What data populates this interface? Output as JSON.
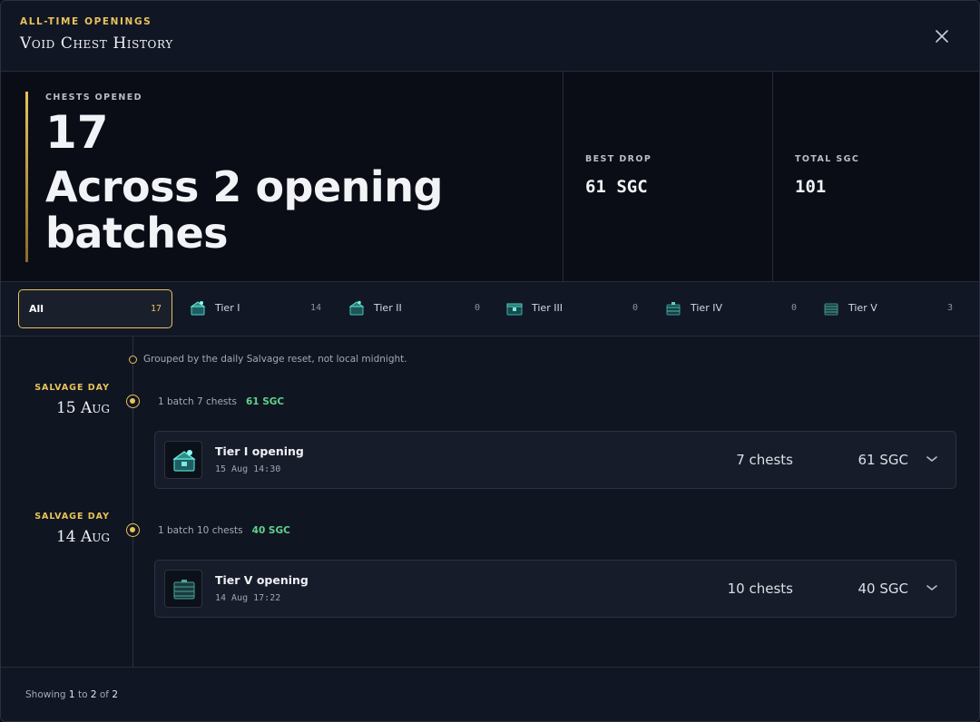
{
  "header": {
    "eyebrow": "ALL-TIME OPENINGS",
    "title": "Void Chest History",
    "close_icon": "close-icon"
  },
  "stats": {
    "opened_label": "CHESTS OPENED",
    "opened_value": "17",
    "opened_sub": "Across 2 opening batches",
    "best_label": "BEST DROP",
    "best_value": "61 SGC",
    "total_label": "TOTAL SGC",
    "total_value": "101"
  },
  "tabs": [
    {
      "label": "All",
      "count": "17",
      "active": true
    },
    {
      "label": "Tier I",
      "count": "14",
      "icon": "tier-1-chest-icon"
    },
    {
      "label": "Tier II",
      "count": "0",
      "icon": "tier-2-chest-icon"
    },
    {
      "label": "Tier III",
      "count": "0",
      "icon": "tier-3-chest-icon"
    },
    {
      "label": "Tier IV",
      "count": "0",
      "icon": "tier-4-chest-icon"
    },
    {
      "label": "Tier V",
      "count": "3",
      "icon": "tier-5-chest-icon"
    }
  ],
  "timeline": {
    "note": "Grouped by the daily Salvage reset, not local midnight.",
    "days": [
      {
        "label": "SALVAGE DAY",
        "date": "15 Aug",
        "batch_text": "1 batch 7 chests",
        "batch_sgc": "61 SGC",
        "card": {
          "name": "Tier I opening",
          "time": "15 Aug 14:30",
          "count": "7 chests",
          "sgc": "61 SGC"
        }
      },
      {
        "label": "SALVAGE DAY",
        "date": "14 Aug",
        "batch_text": "1 batch 10 chests",
        "batch_sgc": "40 SGC",
        "card": {
          "name": "Tier V opening",
          "time": "14 Aug 17:22",
          "count": "10 chests",
          "sgc": "40 SGC"
        }
      }
    ]
  },
  "footer": {
    "prefix": "Showing",
    "from": "1",
    "to_word": "to",
    "to": "2",
    "of_word": "of",
    "total": "2"
  },
  "colors": {
    "accent": "#e8c35a",
    "sgc_green": "#5fd28a",
    "chest_teal": "#3fc4b8"
  }
}
